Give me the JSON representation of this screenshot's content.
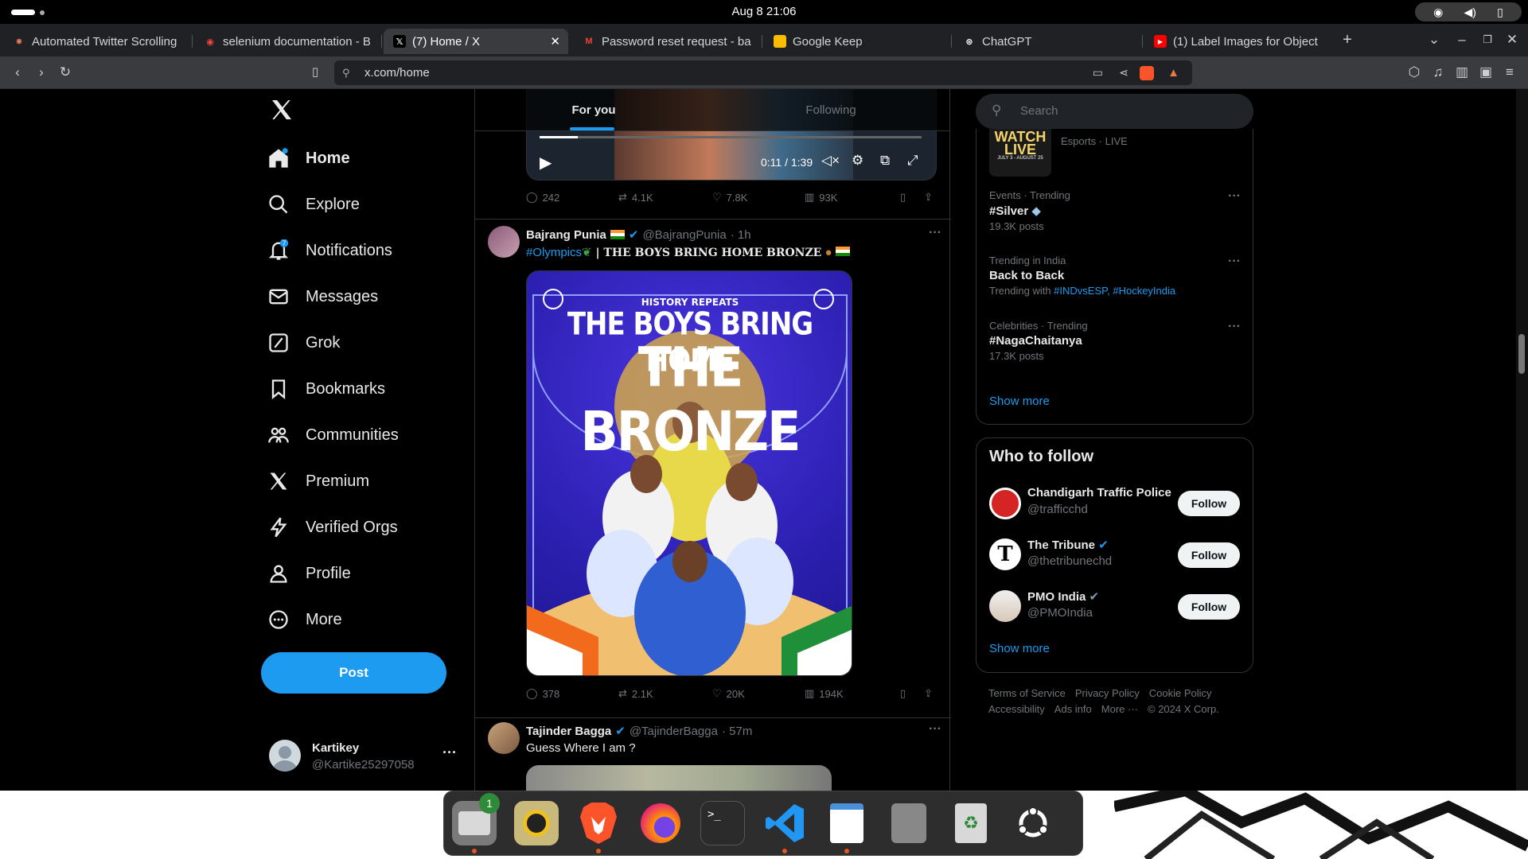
{
  "topbar": {
    "clock": "Aug 8  21:06"
  },
  "tabs": [
    {
      "label": "Automated Twitter Scrolling",
      "fav_color": "#d97757",
      "fav_glyph": "✸"
    },
    {
      "label": "selenium documentation - B",
      "fav_color": "#f44",
      "fav_glyph": "◉"
    },
    {
      "label": "(7) Home / X",
      "fav_color": "#000",
      "fav_glyph": "𝕏"
    },
    {
      "label": "Password reset request - ba",
      "fav_color": "#fff",
      "fav_glyph": "M"
    },
    {
      "label": "Google Keep",
      "fav_color": "#fbbc04",
      "fav_glyph": "▮"
    },
    {
      "label": "ChatGPT",
      "fav_color": "#fff",
      "fav_glyph": "⊛"
    },
    {
      "label": "(1) Label Images for Object",
      "fav_color": "#f00",
      "fav_glyph": "▶"
    }
  ],
  "toolbar": {
    "url": "x.com/home"
  },
  "nav": {
    "items": [
      {
        "label": "Home",
        "icon": "home-icon"
      },
      {
        "label": "Explore",
        "icon": "search-icon"
      },
      {
        "label": "Notifications",
        "icon": "bell-icon",
        "badge": "7"
      },
      {
        "label": "Messages",
        "icon": "mail-icon"
      },
      {
        "label": "Grok",
        "icon": "grok-icon"
      },
      {
        "label": "Bookmarks",
        "icon": "bookmark-icon"
      },
      {
        "label": "Communities",
        "icon": "people-icon"
      },
      {
        "label": "Premium",
        "icon": "x-icon"
      },
      {
        "label": "Verified Orgs",
        "icon": "bolt-icon"
      },
      {
        "label": "Profile",
        "icon": "person-icon"
      },
      {
        "label": "More",
        "icon": "more-circle-icon"
      }
    ],
    "post_label": "Post",
    "account": {
      "name": "Kartikey",
      "handle": "@Kartike25297058"
    }
  },
  "feed": {
    "tabs": {
      "for_you": "For you",
      "following": "Following"
    },
    "video": {
      "time": "0:11 / 1:39"
    },
    "tweet0_stats": {
      "replies": "242",
      "reposts": "4.1K",
      "likes": "7.8K",
      "views": "93K"
    },
    "tweet1": {
      "name": "Bajrang Punia",
      "handle": "@BajrangPunia",
      "time": "· 1h",
      "hashtag": "#Olympics",
      "text": " | THE BOYS BRING HOME BRONZE",
      "image_small": "HISTORY REPEATS",
      "image_line1": "THE BOYS BRING HOME",
      "image_line2": "THE BRONZE",
      "stats": {
        "replies": "378",
        "reposts": "2.1K",
        "likes": "20K",
        "views": "194K"
      }
    },
    "tweet2": {
      "name": "Tajinder Bagga",
      "handle": "@TajinderBagga",
      "time": "· 57m",
      "text": "Guess Where I am ?"
    }
  },
  "right": {
    "search_placeholder": "Search",
    "live": {
      "banner1": "WATCH",
      "banner2": "LIVE",
      "banner3": "JULY 3 - AUGUST 25",
      "meta": "Esports · LIVE"
    },
    "trends": [
      {
        "meta": "Events · Trending",
        "title": "#Silver",
        "sub": "19.3K posts"
      },
      {
        "meta": "Trending in India",
        "title": "Back to Back",
        "sub_prefix": "Trending with ",
        "sub_tags": "#INDvsESP, #HockeyIndia"
      },
      {
        "meta": "Celebrities · Trending",
        "title": "#NagaChaitanya",
        "sub": "17.3K posts"
      }
    ],
    "show_more": "Show more",
    "who_to_follow": {
      "title": "Who to follow",
      "accounts": [
        {
          "name": "Chandigarh Traffic Police",
          "handle": "@trafficchd"
        },
        {
          "name": "The Tribune",
          "handle": "@thetribunechd"
        },
        {
          "name": "PMO India",
          "handle": "@PMOIndia"
        }
      ],
      "follow_label": "Follow",
      "show_more": "Show more"
    },
    "footer": {
      "line1": [
        "Terms of Service",
        "Privacy Policy",
        "Cookie Policy"
      ],
      "line2": [
        "Accessibility",
        "Ads info",
        "More ···",
        "© 2024 X Corp."
      ]
    }
  },
  "dock": {
    "files_badge": "1"
  }
}
